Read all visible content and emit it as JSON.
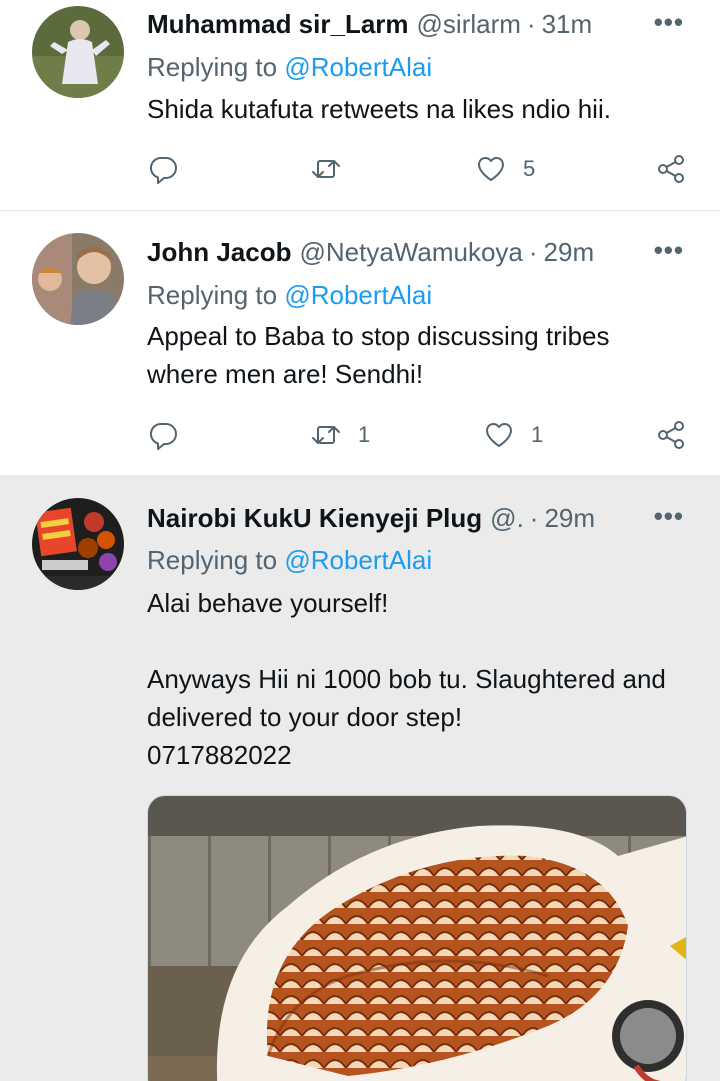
{
  "tweets": [
    {
      "name": "Muhammad sir_Larm",
      "handle": "@sirlarm",
      "time": "31m",
      "replying_prefix": "Replying to ",
      "replying_to": "@RobertAlai",
      "body": [
        "Shida kutafuta retweets na likes ndio hii."
      ],
      "retweets": "",
      "likes": "5"
    },
    {
      "name": "John Jacob",
      "handle": "@NetyaWamukoya",
      "time": "29m",
      "replying_prefix": "Replying to ",
      "replying_to": "@RobertAlai",
      "body": [
        "Appeal to Baba to stop discussing tribes where men are! Sendhi!"
      ],
      "retweets": "1",
      "likes": "1"
    },
    {
      "name": "Nairobi KukU Kienyeji Plug",
      "handle": "@.",
      "time": "29m",
      "replying_prefix": "Replying to ",
      "replying_to": "@RobertAlai",
      "body": [
        "Alai behave yourself!",
        "",
        "Anyways Hii ni 1000 bob tu. Slaughtered and delivered to your door step!",
        "0717882022"
      ],
      "retweets": "",
      "likes": ""
    }
  ],
  "separator": "·",
  "more_label": "•••",
  "icons": {
    "reply": "reply-icon",
    "retweet": "retweet-icon",
    "like": "heart-icon",
    "share": "share-icon",
    "more": "more-icon"
  },
  "colors": {
    "link": "#1d9bf0",
    "secondary": "#536471",
    "highlight_bg": "#ebebeb"
  }
}
